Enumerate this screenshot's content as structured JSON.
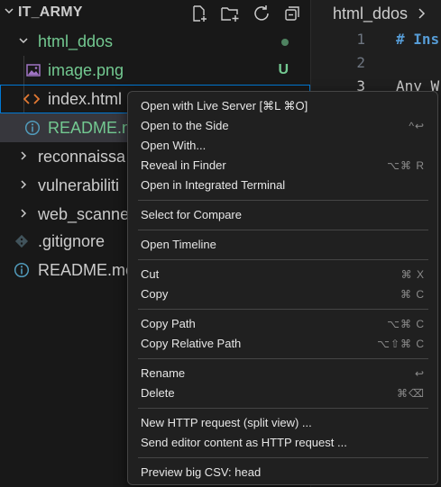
{
  "explorer": {
    "title": "IT_ARMY",
    "actions": [
      "new-file-icon",
      "new-folder-icon",
      "refresh-icon",
      "collapse-all-icon"
    ],
    "tree": {
      "folder": "html_ddos",
      "files": [
        {
          "name": "image.png",
          "status": "U"
        },
        {
          "name": "index.html"
        },
        {
          "name": "README.m"
        }
      ],
      "folders": [
        "reconnaissa",
        "vulnerabiliti",
        "web_scanne"
      ],
      "root_files": [
        ".gitignore",
        "README.mc"
      ]
    }
  },
  "editor": {
    "breadcrumb": "html_ddos",
    "lines": [
      {
        "n": "1",
        "text": "# Ins"
      },
      {
        "n": "2",
        "text": ""
      },
      {
        "n": "3",
        "text": "Any W"
      }
    ]
  },
  "context_menu": {
    "groups": [
      [
        {
          "label": "Open with Live Server [⌘L ⌘O]",
          "key": ""
        },
        {
          "label": "Open to the Side",
          "key": "^↩"
        },
        {
          "label": "Open With...",
          "key": ""
        },
        {
          "label": "Reveal in Finder",
          "key": "⌥⌘ R"
        },
        {
          "label": "Open in Integrated Terminal",
          "key": ""
        }
      ],
      [
        {
          "label": "Select for Compare",
          "key": ""
        }
      ],
      [
        {
          "label": "Open Timeline",
          "key": ""
        }
      ],
      [
        {
          "label": "Cut",
          "key": "⌘ X"
        },
        {
          "label": "Copy",
          "key": "⌘ C"
        }
      ],
      [
        {
          "label": "Copy Path",
          "key": "⌥⌘ C"
        },
        {
          "label": "Copy Relative Path",
          "key": "⌥⇧⌘ C"
        }
      ],
      [
        {
          "label": "Rename",
          "key": "↩"
        },
        {
          "label": "Delete",
          "key": "⌘⌫"
        }
      ],
      [
        {
          "label": "New HTTP request (split view) ...",
          "key": ""
        },
        {
          "label": "Send editor content as HTTP request ...",
          "key": ""
        }
      ],
      [
        {
          "label": "Preview big CSV: head",
          "key": ""
        }
      ]
    ]
  },
  "colors": {
    "accent": "#0078d4",
    "untracked": "#73c991",
    "image_icon": "#a074c4",
    "html_icon": "#e37933",
    "info_icon": "#519aba"
  }
}
